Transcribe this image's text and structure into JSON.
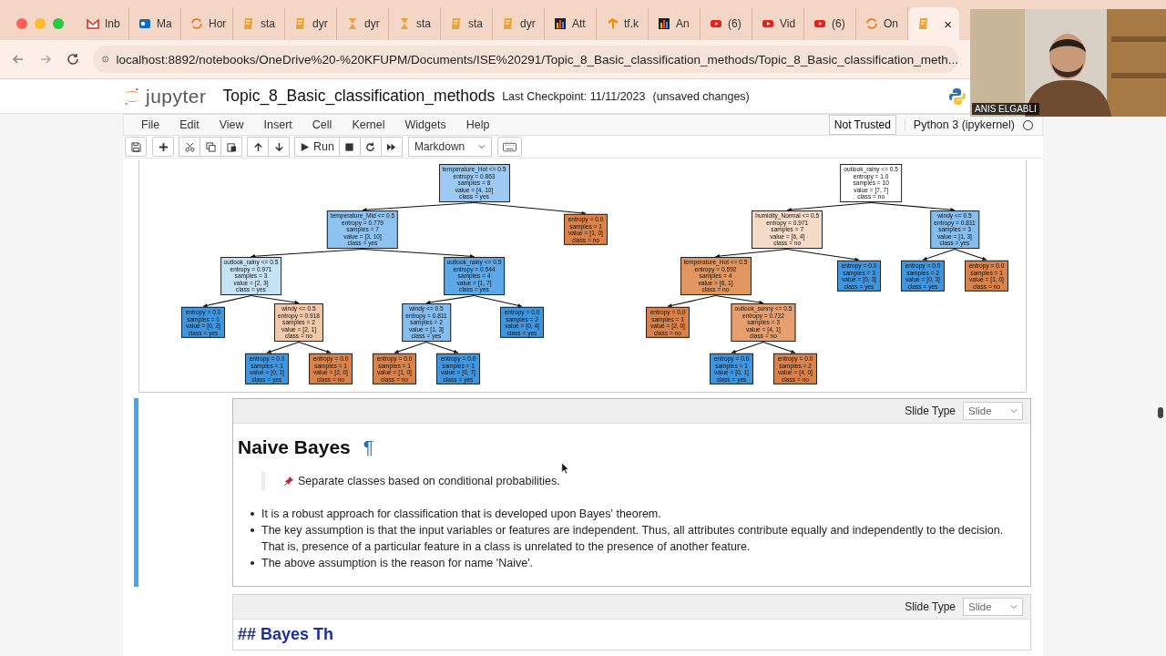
{
  "browser": {
    "tabs": [
      {
        "label": "Inb",
        "kind": "mail",
        "selected": false
      },
      {
        "label": "Ma",
        "kind": "outlook",
        "selected": false
      },
      {
        "label": "Hor",
        "kind": "ring",
        "selected": false
      },
      {
        "label": "sta",
        "kind": "book",
        "selected": false
      },
      {
        "label": "dyr",
        "kind": "book",
        "selected": false
      },
      {
        "label": "dyr",
        "kind": "hourglass",
        "selected": false
      },
      {
        "label": "sta",
        "kind": "hourglass",
        "selected": false
      },
      {
        "label": "sta",
        "kind": "book",
        "selected": false
      },
      {
        "label": "dyr",
        "kind": "book",
        "selected": false
      },
      {
        "label": "Att",
        "kind": "bars",
        "selected": false
      },
      {
        "label": "tf.k",
        "kind": "tf",
        "selected": false
      },
      {
        "label": "An",
        "kind": "bars",
        "selected": false
      },
      {
        "label": "(6)",
        "kind": "video",
        "selected": false
      },
      {
        "label": "Vid",
        "kind": "video",
        "selected": false
      },
      {
        "label": "(6)",
        "kind": "video",
        "selected": false
      },
      {
        "label": "On",
        "kind": "ring",
        "selected": false
      },
      {
        "label": "×",
        "kind": "book",
        "selected": true
      }
    ],
    "url": "localhost:8892/notebooks/OneDrive%20-%20KFUPM/Documents/ISE%20291/Topic_8_Basic_classification_methods/Topic_8_Basic_classification_meth..."
  },
  "notebook": {
    "brand": "jupyter",
    "title": "Topic_8_Basic_classification_methods",
    "checkpoint": "Last Checkpoint: 11/11/2023",
    "status": "(unsaved changes)",
    "menu": [
      "File",
      "Edit",
      "View",
      "Insert",
      "Cell",
      "Kernel",
      "Widgets",
      "Help"
    ],
    "trust": "Not Trusted",
    "kernel": "Python 3 (ipykernel)",
    "run": "Run",
    "cell_type": "Markdown"
  },
  "output": {
    "trees": [
      {
        "lines": [
          "temperature_Hot <= 0.5",
          "entropy = 0.863",
          "samples = 8",
          "value = [4, 10]",
          "class = yes"
        ],
        "color": "#9ccaf3",
        "children": [
          {
            "lines": [
              "temperature_Mid <= 0.5",
              "entropy = 0.779",
              "samples = 7",
              "value = [3, 10]",
              "class = yes"
            ],
            "color": "#8ec2f0",
            "children": [
              {
                "lines": [
                  "outlook_rainy <= 0.5",
                  "entropy = 0.971",
                  "samples = 3",
                  "value = [2, 3]",
                  "class = yes"
                ],
                "color": "#c6e2f7",
                "children": [
                  {
                    "lines": [
                      "entropy = 0.0",
                      "samples = 1",
                      "value = [0, 2]",
                      "class = yes"
                    ],
                    "color": "#3f95de"
                  },
                  {
                    "lines": [
                      "windy <= 0.5",
                      "entropy = 0.918",
                      "samples = 2",
                      "value = [2, 1]",
                      "class = no"
                    ],
                    "color": "#f2c8aa",
                    "children": [
                      {
                        "lines": [
                          "entropy = 0.0",
                          "samples = 1",
                          "value = [0, 1]",
                          "class = yes"
                        ],
                        "color": "#3f95de"
                      },
                      {
                        "lines": [
                          "entropy = 0.0",
                          "samples = 1",
                          "value = [2, 0]",
                          "class = no"
                        ],
                        "color": "#d9824a"
                      }
                    ]
                  }
                ]
              },
              {
                "lines": [
                  "outlook_rainy <= 0.5",
                  "entropy = 0.544",
                  "samples = 4",
                  "value = [1, 7]",
                  "class = yes"
                ],
                "color": "#5ea8e8",
                "children": [
                  {
                    "lines": [
                      "windy <= 0.5",
                      "entropy = 0.811",
                      "samples = 2",
                      "value = [1, 3]",
                      "class = yes"
                    ],
                    "color": "#85bdef",
                    "children": [
                      {
                        "lines": [
                          "entropy = 0.0",
                          "samples = 1",
                          "value = [1, 0]",
                          "class = no"
                        ],
                        "color": "#d9824a"
                      },
                      {
                        "lines": [
                          "entropy = 0.0",
                          "samples = 1",
                          "value = [0, 7]",
                          "class = yes"
                        ],
                        "color": "#3f95de"
                      }
                    ]
                  },
                  {
                    "lines": [
                      "entropy = 0.0",
                      "samples = 2",
                      "value = [0, 4]",
                      "class = yes"
                    ],
                    "color": "#3f95de"
                  }
                ]
              }
            ]
          },
          {
            "lines": [
              "entropy = 0.0",
              "samples = 1",
              "value = [1, 0]",
              "class = no"
            ],
            "color": "#d9824a"
          }
        ]
      },
      {
        "lines": [
          "outlook_rainy <= 0.5",
          "entropy = 1.0",
          "samples = 10",
          "value = [7, 7]",
          "class = no"
        ],
        "color": "#ffffff",
        "children": [
          {
            "lines": [
              "humidity_Normal <= 0.5",
              "entropy = 0.971",
              "samples = 7",
              "value = [6, 4]",
              "class = no"
            ],
            "color": "#f6dcc8",
            "children": [
              {
                "lines": [
                  "temperature_Hot <= 0.5",
                  "entropy = 0.592",
                  "samples = 4",
                  "value = [6, 1]",
                  "class = no"
                ],
                "color": "#e0965e",
                "children": [
                  {
                    "lines": [
                      "entropy = 0.0",
                      "samples = 1",
                      "value = [2, 0]",
                      "class = no"
                    ],
                    "color": "#d9824a"
                  },
                  {
                    "lines": [
                      "outlook_sunny <= 0.5",
                      "entropy = 0.722",
                      "samples = 3",
                      "value = [4, 1]",
                      "class = no"
                    ],
                    "color": "#e6a070",
                    "children": [
                      {
                        "lines": [
                          "entropy = 0.0",
                          "samples = 1",
                          "value = [0, 1]",
                          "class = yes"
                        ],
                        "color": "#3f95de"
                      },
                      {
                        "lines": [
                          "entropy = 0.0",
                          "samples = 2",
                          "value = [4, 0]",
                          "class = no"
                        ],
                        "color": "#d9824a"
                      }
                    ]
                  }
                ]
              },
              {
                "lines": [
                  "entropy = 0.0",
                  "samples = 3",
                  "value = [0, 3]",
                  "class = yes"
                ],
                "color": "#3f95de"
              }
            ]
          },
          {
            "lines": [
              "windy <= 0.5",
              "entropy = 0.811",
              "samples = 3",
              "value = [1, 3]",
              "class = yes"
            ],
            "color": "#85bdef",
            "children": [
              {
                "lines": [
                  "entropy = 0.0",
                  "samples = 2",
                  "value = [0, 3]",
                  "class = yes"
                ],
                "color": "#3f95de"
              },
              {
                "lines": [
                  "entropy = 0.0",
                  "samples = 1",
                  "value = [1, 0]",
                  "class = no"
                ],
                "color": "#d9824a"
              }
            ]
          }
        ]
      }
    ]
  },
  "cells": [
    {
      "kind": "markdown",
      "selected": true,
      "slide_label": "Slide Type",
      "slide_type": "Slide",
      "heading": "Naive Bayes",
      "anchor": "¶",
      "note": "Separate classes based on conditional probabilities.",
      "bullets": [
        "It is a robust approach for classification that is developed upon Bayes' theorem.",
        "The key assumption is that the input variables or features are independent. Thus, all attributes contribute equally and independently to the decision. That is, presence of a particular feature in a class is unrelated to the presence of another feature.",
        "The above assumption is the reason for name 'Naive'."
      ]
    },
    {
      "kind": "raw",
      "selected": false,
      "slide_label": "Slide Type",
      "slide_type": "Slide",
      "source": "## Bayes Th"
    }
  ],
  "webcam": {
    "name": "ANIS ELGABLI"
  }
}
